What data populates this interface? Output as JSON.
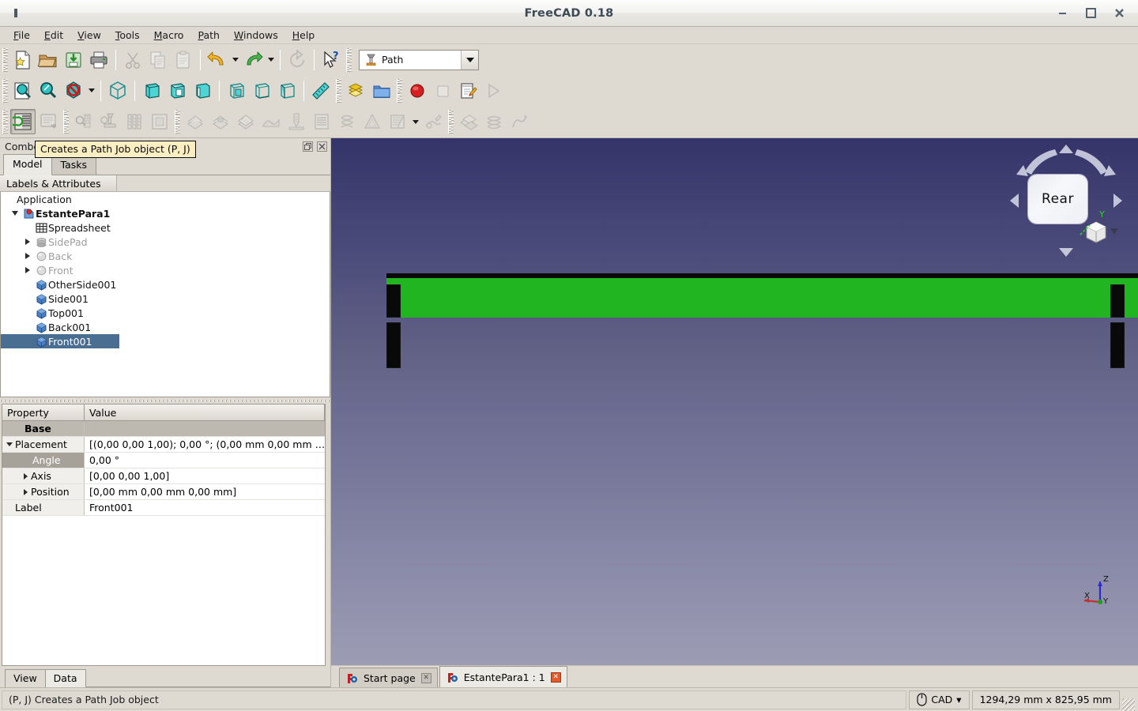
{
  "window": {
    "title": "FreeCAD 0.18",
    "minimize_label": "–",
    "maximize_label": "□",
    "close_label": "✖"
  },
  "menubar": {
    "items": [
      {
        "label": "File",
        "mnemonic": "F"
      },
      {
        "label": "Edit",
        "mnemonic": "E"
      },
      {
        "label": "View",
        "mnemonic": "V"
      },
      {
        "label": "Tools",
        "mnemonic": "T"
      },
      {
        "label": "Macro",
        "mnemonic": "M"
      },
      {
        "label": "Path",
        "mnemonic": "P"
      },
      {
        "label": "Windows",
        "mnemonic": "W"
      },
      {
        "label": "Help",
        "mnemonic": "H"
      }
    ]
  },
  "toolbar_file": {
    "buttons": [
      {
        "name": "new-document-button",
        "icon": "new-document-icon"
      },
      {
        "name": "open-document-button",
        "icon": "open-folder-icon"
      },
      {
        "name": "save-document-button",
        "icon": "save-icon"
      },
      {
        "name": "print-button",
        "icon": "printer-icon"
      },
      {
        "name": "cut-button",
        "icon": "scissors-icon"
      },
      {
        "name": "copy-button",
        "icon": "copy-icon"
      },
      {
        "name": "paste-button",
        "icon": "clipboard-icon"
      },
      {
        "name": "undo-button",
        "icon": "undo-arrow-icon"
      },
      {
        "name": "redo-button",
        "icon": "redo-arrow-icon"
      },
      {
        "name": "refresh-button",
        "icon": "refresh-icon"
      },
      {
        "name": "whats-this-button",
        "icon": "cursor-question-icon"
      }
    ]
  },
  "workbench_selector": {
    "value": "Path",
    "icon": "path-workbench-icon"
  },
  "toolbar_view": {
    "buttons": [
      {
        "name": "fit-all-button",
        "icon": "fit-all-icon"
      },
      {
        "name": "fit-selection-button",
        "icon": "zoom-selection-icon"
      },
      {
        "name": "draw-style-button",
        "icon": "draw-style-icon"
      },
      {
        "name": "isometric-view-button",
        "icon": "axonometric-cube-icon"
      },
      {
        "name": "front-view-button",
        "icon": "front-view-icon"
      },
      {
        "name": "top-view-button",
        "icon": "top-view-icon"
      },
      {
        "name": "right-view-button",
        "icon": "right-view-icon"
      },
      {
        "name": "rear-view-button",
        "icon": "rear-view-icon"
      },
      {
        "name": "bottom-view-button",
        "icon": "bottom-view-icon"
      },
      {
        "name": "left-view-button",
        "icon": "left-view-icon"
      },
      {
        "name": "measure-button",
        "icon": "ruler-icon"
      },
      {
        "name": "create-group-button",
        "icon": "yellow-blocks-icon"
      },
      {
        "name": "create-folder-button",
        "icon": "blue-folder-icon"
      },
      {
        "name": "macro-record-button",
        "icon": "record-red-dot-icon"
      },
      {
        "name": "macro-stop-button",
        "icon": "stop-square-icon"
      },
      {
        "name": "macro-edit-button",
        "icon": "notepad-pencil-icon"
      },
      {
        "name": "macro-execute-button",
        "icon": "play-triangle-icon"
      }
    ]
  },
  "toolbar_path": {
    "buttons": [
      {
        "name": "path-job-button",
        "icon": "path-job-icon",
        "pressed": true
      },
      {
        "name": "path-post-process-button",
        "icon": "path-post-process-icon"
      },
      {
        "name": "path-inspect-button",
        "icon": "path-inspect-icon"
      },
      {
        "name": "path-toolcontroller-button",
        "icon": "path-toolcontroller-icon"
      },
      {
        "name": "path-toolbit-library-button",
        "icon": "path-drillbits-icon"
      },
      {
        "name": "path-stock-button",
        "icon": "path-stock-icon"
      },
      {
        "name": "path-profile-button",
        "icon": "path-profile-icon"
      },
      {
        "name": "path-pocket-shape-button",
        "icon": "path-pocket-icon"
      },
      {
        "name": "path-face-button",
        "icon": "path-face-icon"
      },
      {
        "name": "path-3d-surface-button",
        "icon": "path-surface-icon"
      },
      {
        "name": "path-drilling-button",
        "icon": "path-drilling-icon"
      },
      {
        "name": "path-engrave-button",
        "icon": "path-engrave-icon"
      },
      {
        "name": "path-helix-button",
        "icon": "path-helix-icon"
      },
      {
        "name": "path-adaptive-button",
        "icon": "path-adaptive-icon"
      },
      {
        "name": "path-slot-button",
        "icon": "path-slot-icon"
      },
      {
        "name": "path-deburr-button",
        "icon": "path-deburr-icon"
      },
      {
        "name": "path-array-button",
        "icon": "path-array-icon"
      },
      {
        "name": "path-copy-button",
        "icon": "path-copy-icon"
      },
      {
        "name": "path-simplecopy-button",
        "icon": "path-simplecopy-icon"
      }
    ]
  },
  "tooltip": {
    "text": "Creates a Path Job object (P, J)"
  },
  "combo_view": {
    "title": "Combo View",
    "float_label": "❐",
    "close_label": "✖",
    "tabs": [
      {
        "label": "Model",
        "active": true
      },
      {
        "label": "Tasks",
        "active": false
      }
    ],
    "tree_header": "Labels & Attributes",
    "tree": [
      {
        "label": "Application",
        "indent": 0,
        "expander": "none",
        "icon": "none",
        "state": "normal"
      },
      {
        "label": "EstantePara1",
        "indent": 1,
        "expander": "open",
        "icon": "document-icon",
        "state": "bold"
      },
      {
        "label": "Spreadsheet",
        "indent": 2,
        "expander": "none",
        "icon": "spreadsheet-icon",
        "state": "normal"
      },
      {
        "label": "SidePad",
        "indent": 2,
        "expander": "closed",
        "icon": "pad-icon",
        "state": "dim"
      },
      {
        "label": "Back",
        "indent": 2,
        "expander": "closed",
        "icon": "sphere-icon",
        "state": "dim"
      },
      {
        "label": "Front",
        "indent": 2,
        "expander": "closed",
        "icon": "sphere-icon",
        "state": "dim"
      },
      {
        "label": "OtherSide001",
        "indent": 2,
        "expander": "none",
        "icon": "box-icon",
        "state": "normal"
      },
      {
        "label": "Side001",
        "indent": 2,
        "expander": "none",
        "icon": "box-icon",
        "state": "normal"
      },
      {
        "label": "Top001",
        "indent": 2,
        "expander": "none",
        "icon": "box-icon",
        "state": "normal"
      },
      {
        "label": "Back001",
        "indent": 2,
        "expander": "none",
        "icon": "box-icon",
        "state": "normal"
      },
      {
        "label": "Front001",
        "indent": 2,
        "expander": "none",
        "icon": "box-icon",
        "state": "selected"
      }
    ],
    "property_columns": {
      "name": "Property",
      "value": "Value"
    },
    "properties": [
      {
        "kind": "group",
        "name": "Base",
        "value": ""
      },
      {
        "kind": "row",
        "expander": "open",
        "name": "Placement",
        "value": "[(0,00 0,00 1,00); 0,00 °; (0,00 mm  0,00 mm  …"
      },
      {
        "kind": "sub",
        "expander": "none",
        "name": "Angle",
        "value": "0,00 °"
      },
      {
        "kind": "row",
        "expander": "closed",
        "name": "Axis",
        "value": "[0,00 0,00 1,00]",
        "indented": true
      },
      {
        "kind": "row",
        "expander": "closed",
        "name": "Position",
        "value": "[0,00 mm  0,00 mm  0,00 mm]",
        "indented": true
      },
      {
        "kind": "row",
        "expander": "none",
        "name": "Label",
        "value": "Front001"
      }
    ],
    "bottom_tabs": [
      {
        "label": "View",
        "active": true
      },
      {
        "label": "Data",
        "active": false
      }
    ]
  },
  "viewport": {
    "navcube": {
      "face_label": "Rear",
      "arrow_up": "arrow-up-icon",
      "arrow_down": "arrow-down-icon",
      "arrow_left": "arrow-left-icon",
      "arrow_right": "arrow-right-icon",
      "rotate_left": "rotate-left-icon",
      "rotate_right": "rotate-right-icon",
      "corner_cube": "corner-cube-icon",
      "axis_hint": "Y"
    },
    "axis_indicator": {
      "x_label": "X",
      "y_label": "Y",
      "z_label": "Z",
      "x_color": "#c03030",
      "y_color": "#1e9e1e",
      "z_color": "#2a2ad0"
    },
    "shape_color_selected": "#22b522",
    "shape_color_dark": "#090909"
  },
  "document_tabs": [
    {
      "label": "Start page",
      "active": false,
      "close_style": "grey",
      "icon": "freecad-icon"
    },
    {
      "label": "EstantePara1 : 1",
      "active": true,
      "close_style": "red",
      "icon": "freecad-icon"
    }
  ],
  "statusbar": {
    "message": "(P, J) Creates a Path Job object",
    "navigation_style": "CAD",
    "navigation_icon": "mouse-icon",
    "navigation_arrow": "▾",
    "dimensions": "1294,29 mm x 825,95 mm"
  }
}
